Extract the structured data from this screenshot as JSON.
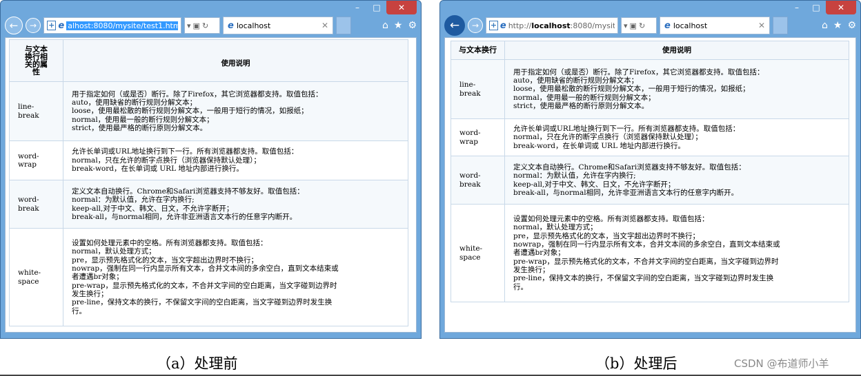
{
  "window_a": {
    "url": "alhost:8080/mysite/test1.html",
    "tab_title": "localhost"
  },
  "window_b": {
    "url_prefix": "http://",
    "url_host": "localhost",
    "url_rest": ":8080/mysite/t",
    "tab_title": "localhost"
  },
  "table": {
    "header_prop_a": [
      "与文本",
      "换行相",
      "关的属",
      "性"
    ],
    "header_prop_b": "与文本换行",
    "header_desc": "使用说明",
    "rows": [
      {
        "prop_a": [
          "line-",
          "break"
        ],
        "prop_b": [
          "line-",
          "break"
        ],
        "lines": [
          "用于指定如何（或是否）断行。除了Firefox，其它浏览器都支持。取值包括：",
          "auto，使用缺省的断行规则分解文本；",
          "loose，使用最松散的断行规则分解文本，一般用于短行的情况，如报纸；",
          "normal，使用最一般的断行规则分解文本；",
          "strict，使用最严格的断行原则分解文本。"
        ]
      },
      {
        "prop_a": [
          "word-",
          "wrap"
        ],
        "prop_b": [
          "word-",
          "wrap"
        ],
        "lines": [
          "允许长单词或URL地址换行到下一行。所有浏览器都支持。取值包括：",
          "normal，只在允许的断字点换行（浏览器保持默认处理）；",
          "break-word，在长单词或 URL 地址内部进行换行。"
        ]
      },
      {
        "prop_a": [
          "word-",
          "break"
        ],
        "prop_b": [
          "word-",
          "break"
        ],
        "lines": [
          "定义文本自动换行。Chrome和Safari浏览器支持不够友好。取值包括：",
          "normal：为默认值，允许在字内换行;",
          "keep-all,对于中文、韩文、日文，不允许字断开；",
          "break-all，与normal相同，允许非亚洲语言文本行的任意字内断开。"
        ]
      },
      {
        "prop_a": [
          "white-",
          "space"
        ],
        "prop_b": [
          "white-",
          "space"
        ],
        "lines_a": [
          "设置如何处理元素中的空格。所有浏览器都支持。取值包括：",
          "normal，默认处理方式；",
          "pre，显示预先格式化的文本，当文字超出边界时不换行；",
          "nowrap，强制在同一行内显示所有文本，合并文本间的多余空白，直到文本结束或",
          "者遭遇br对象；",
          "pre-wrap，显示预先格式化的文本，不合并文字间的空白距离，当文字碰到边界时",
          "发生换行；",
          "pre-line，保持文本的换行，不保留文字间的空白距离，当文字碰到边界时发生换",
          "行。"
        ],
        "lines_b": [
          "设置如何处理元素中的空格。所有浏览器都支持。取值包括：",
          "normal，默认处理方式；",
          "pre，显示预先格式化的文本，当文字超出边界时不换行；",
          "nowrap，强制在同一行内显示所有文本，合并文本间的多余空白，直到文本结束或",
          "者遭遇br对象；",
          "pre-wrap，显示预先格式化的文本，不合并文字间的空白距离，当文字碰到边界时",
          "发生换行；",
          "pre-line，保持文本的换行，不保留文字间的空白距离，当文字碰到边界时发生换",
          "行。"
        ]
      }
    ]
  },
  "captions": {
    "a": "（a）处理前",
    "b": "（b）处理后",
    "watermark": "CSDN @布道师小羊"
  },
  "icons": [
    "minimize-icon",
    "maximize-icon",
    "close-icon",
    "back-icon",
    "forward-icon",
    "ie-logo-icon",
    "refresh-icon",
    "home-icon",
    "star-icon",
    "gear-icon"
  ]
}
